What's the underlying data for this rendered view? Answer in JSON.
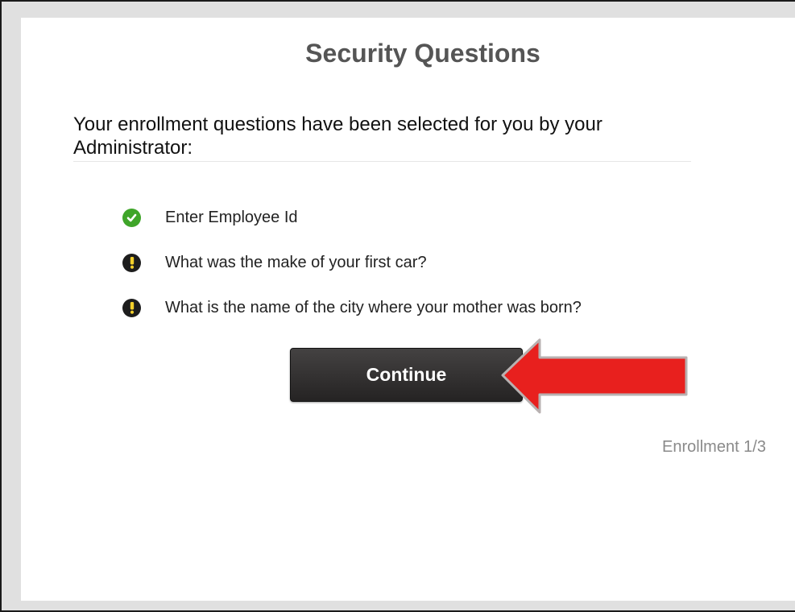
{
  "page": {
    "title": "Security Questions",
    "intro": "Your enrollment questions have been selected for you by your Administrator:"
  },
  "questions": [
    {
      "text": "Enter Employee Id",
      "status": "complete",
      "icon": "checkmark-icon"
    },
    {
      "text": "What was the make of your first car?",
      "status": "pending",
      "icon": "exclamation-icon"
    },
    {
      "text": "What is the name of the city where your mother was born?",
      "status": "pending",
      "icon": "exclamation-icon"
    }
  ],
  "actions": {
    "continue_label": "Continue"
  },
  "status": {
    "enrollment": "Enrollment 1/3"
  },
  "colors": {
    "complete": "#3fa529",
    "pending": "#1d1d1d",
    "arrow": "#e8201e",
    "title": "#555555"
  }
}
